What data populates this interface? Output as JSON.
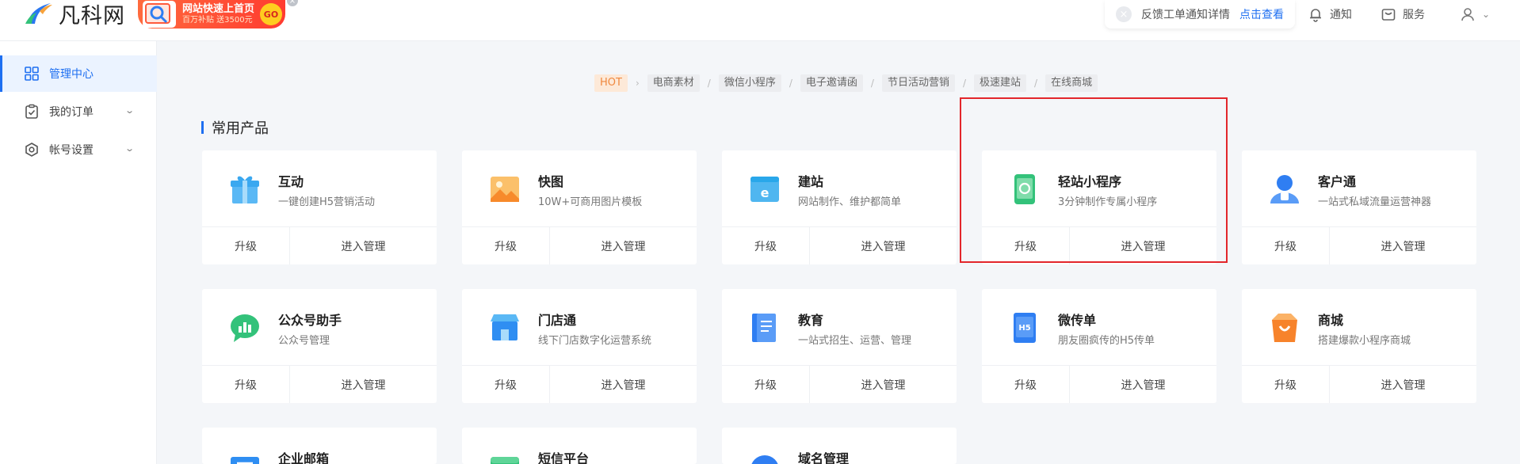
{
  "app": {
    "logo_text": "凡科网",
    "promo_main": "网站快速上首页",
    "promo_sub": "百万补贴 送3500元",
    "promo_go": "GO",
    "promo_close": "×"
  },
  "topbar": {
    "notice_close": "×",
    "notice_text": "反馈工单通知详情",
    "notice_link": "点击查看",
    "notify_label": "通知",
    "service_label": "服务",
    "user_chevron": "⌄"
  },
  "sidebar": {
    "items": [
      {
        "label": "管理中心",
        "icon": "grid-icon",
        "active": true
      },
      {
        "label": "我的订单",
        "icon": "order-icon",
        "chevron": "⌄"
      },
      {
        "label": "帐号设置",
        "icon": "settings-icon",
        "chevron": "⌄"
      }
    ]
  },
  "tags": {
    "hot": "HOT",
    "arrow": "›",
    "sep": "/",
    "items": [
      "电商素材",
      "微信小程序",
      "电子邀请函",
      "节日活动营销",
      "极速建站",
      "在线商城"
    ]
  },
  "section": {
    "title": "常用产品"
  },
  "cards": [
    {
      "name": "互动",
      "desc": "一键创建H5营销活动",
      "upgrade": "升级",
      "manage": "进入管理",
      "icon": "gift-icon",
      "color": "#3aa8f0"
    },
    {
      "name": "快图",
      "desc": "10W+可商用图片模板",
      "upgrade": "升级",
      "manage": "进入管理",
      "icon": "image-icon",
      "color": "#f7a23b"
    },
    {
      "name": "建站",
      "desc": "网站制作、维护都简单",
      "upgrade": "升级",
      "manage": "进入管理",
      "icon": "browser-icon",
      "color": "#29a7ea"
    },
    {
      "name": "轻站小程序",
      "desc": "3分钟制作专属小程序",
      "upgrade": "升级",
      "manage": "进入管理",
      "icon": "miniapp-icon",
      "color": "#33c27a"
    },
    {
      "name": "客户通",
      "desc": "一站式私域流量运营神器",
      "upgrade": "升级",
      "manage": "进入管理",
      "icon": "customer-icon",
      "color": "#2f7ef2"
    },
    {
      "name": "公众号助手",
      "desc": "公众号管理",
      "upgrade": "升级",
      "manage": "进入管理",
      "icon": "chat-icon",
      "color": "#33c27a"
    },
    {
      "name": "门店通",
      "desc": "线下门店数字化运营系统",
      "upgrade": "升级",
      "manage": "进入管理",
      "icon": "store-icon",
      "color": "#2f8ef2"
    },
    {
      "name": "教育",
      "desc": "一站式招生、运营、管理",
      "upgrade": "升级",
      "manage": "进入管理",
      "icon": "book-icon",
      "color": "#2f7ef2"
    },
    {
      "name": "微传单",
      "desc": "朋友圈疯传的H5传单",
      "upgrade": "升级",
      "manage": "进入管理",
      "icon": "h5-icon",
      "color": "#2f7ef2",
      "badge": "H5"
    },
    {
      "name": "商城",
      "desc": "搭建爆款小程序商城",
      "upgrade": "升级",
      "manage": "进入管理",
      "icon": "bag-icon",
      "color": "#f7832b"
    },
    {
      "name": "企业邮箱",
      "icon": "mail-icon",
      "color": "#2f8ef2"
    },
    {
      "name": "短信平台",
      "icon": "sms-icon",
      "color": "#33c27a"
    },
    {
      "name": "域名管理",
      "icon": "globe-icon",
      "color": "#2f7ef2"
    }
  ]
}
